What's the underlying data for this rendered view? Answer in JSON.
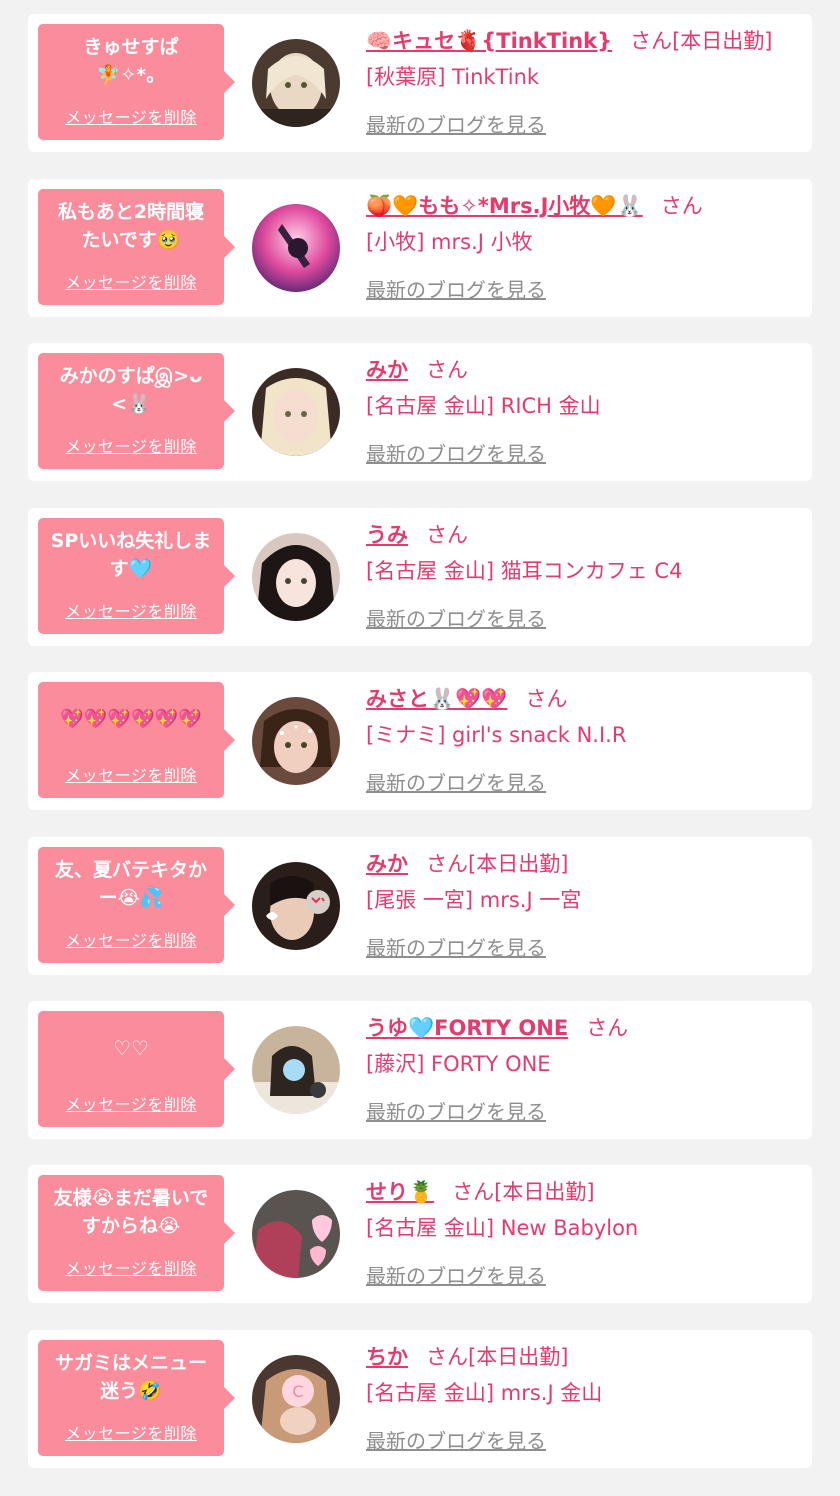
{
  "delete_label": "メッセージを削除",
  "blog_label": "最新のブログを見る",
  "accent_color": "#e53a6c",
  "bubble_color": "#fa8c9b",
  "items": [
    {
      "message": "きゅせすぱ\n🧚✧*。",
      "name": "🧠キュセ🫀{TinkTink}",
      "suffix": "さん[本日出勤]",
      "shop": "[秋葉原] TinkTink"
    },
    {
      "message": "私もあと2時間寝\nたいです🥹",
      "name": "🍑🧡もも✧*Mrs.J小牧🧡🐰",
      "suffix": "さん",
      "shop": "[小牧] mrs.J 小牧"
    },
    {
      "message": "みかのすぱஇ>ᴗ\n<🐰",
      "name": "みか",
      "suffix": "さん",
      "shop": "[名古屋 金山] RICH 金山"
    },
    {
      "message": "SPいいね失礼しま\nす🩵",
      "name": "うみ",
      "suffix": "さん",
      "shop": "[名古屋 金山] 猫耳コンカフェ C4"
    },
    {
      "message": "💖💖💖💖💖💖",
      "name": "みさと🐰💖💖",
      "suffix": "さん",
      "shop": "[ミナミ] girl's snack N.I.R"
    },
    {
      "message": "友、夏バテキタか\nー😭💦",
      "name": "みか",
      "suffix": "さん[本日出勤]",
      "shop": "[尾張 一宮] mrs.J 一宮"
    },
    {
      "message": "♡♡",
      "name": "うゆ🩵FORTY ONE",
      "suffix": "さん",
      "shop": "[藤沢] FORTY ONE"
    },
    {
      "message": "友様😭まだ暑いで\nすからね😭",
      "name": "せり🍍",
      "suffix": "さん[本日出勤]",
      "shop": "[名古屋 金山] New Babylon"
    },
    {
      "message": "サガミはメニュー\n迷う🤣",
      "name": "ちか",
      "suffix": "さん[本日出勤]",
      "shop": "[名古屋 金山] mrs.J 金山"
    }
  ]
}
